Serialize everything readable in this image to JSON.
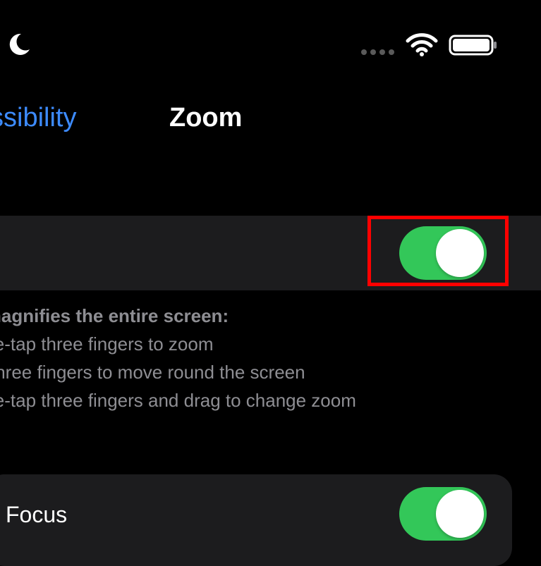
{
  "status_bar": {
    "moon_icon": "crescent-moon-icon",
    "signal_icon": "cellular-signal-icon",
    "wifi_icon": "wifi-icon",
    "battery_icon": "battery-icon"
  },
  "nav": {
    "back_label": "ssibility",
    "title": "Zoom"
  },
  "zoom_row": {
    "toggle_on": true
  },
  "description": {
    "heading": "nagnifies the entire screen:",
    "lines": [
      "le-tap three fingers to zoom",
      "three fingers to move round the screen",
      "le-tap three fingers and drag to change zoom"
    ]
  },
  "focus_row": {
    "label": "Focus",
    "toggle_on": true
  },
  "colors": {
    "accent": "#3d8bfd",
    "toggle_on": "#33c759",
    "highlight": "#ff0000",
    "cell_bg": "#1c1c1e",
    "secondary_text": "#8e8e93"
  }
}
